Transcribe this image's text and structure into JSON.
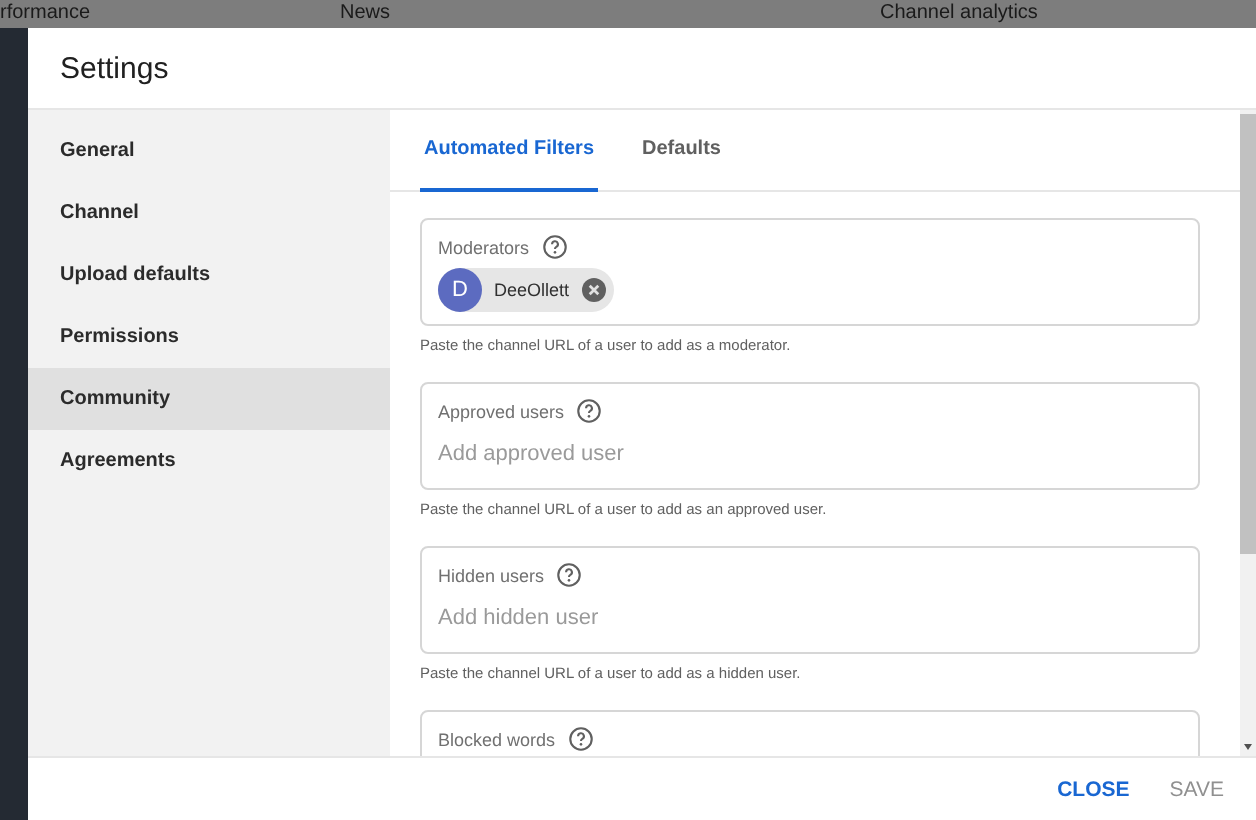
{
  "backdrop": {
    "tabs": [
      "rformance",
      "News",
      "Channel analytics"
    ]
  },
  "dialog": {
    "title": "Settings",
    "sidebar": {
      "items": [
        {
          "label": "General",
          "selected": false
        },
        {
          "label": "Channel",
          "selected": false
        },
        {
          "label": "Upload defaults",
          "selected": false
        },
        {
          "label": "Permissions",
          "selected": false
        },
        {
          "label": "Community",
          "selected": true
        },
        {
          "label": "Agreements",
          "selected": false
        }
      ]
    },
    "tabs": [
      {
        "label": "Automated Filters",
        "selected": true
      },
      {
        "label": "Defaults",
        "selected": false
      }
    ],
    "fields": [
      {
        "label": "Moderators",
        "chips": [
          {
            "initial": "D",
            "name": "DeeOllett"
          }
        ],
        "helper": "Paste the channel URL of a user to add as a moderator."
      },
      {
        "label": "Approved users",
        "placeholder": "Add approved user",
        "helper": "Paste the channel URL of a user to add as an approved user."
      },
      {
        "label": "Hidden users",
        "placeholder": "Add hidden user",
        "helper": "Paste the channel URL of a user to add as a hidden user."
      },
      {
        "label": "Blocked words"
      }
    ],
    "buttons": [
      {
        "label": "CLOSE",
        "disabled": false
      },
      {
        "label": "SAVE",
        "disabled": true
      }
    ]
  }
}
